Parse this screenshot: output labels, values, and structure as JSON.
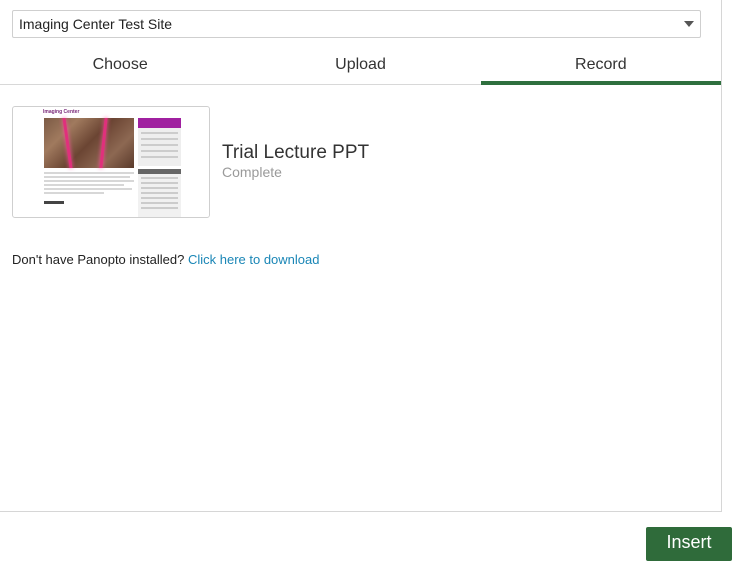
{
  "folder_select": {
    "selected": "Imaging Center Test Site",
    "icon": "chevron-down-icon"
  },
  "tabs": [
    {
      "label": "Choose",
      "active": false
    },
    {
      "label": "Upload",
      "active": false
    },
    {
      "label": "Record",
      "active": true
    }
  ],
  "session": {
    "name": "Trial Lecture PPT",
    "status": "Complete",
    "thumbnail": {
      "site_title": "Imaging Center"
    }
  },
  "download": {
    "prompt": "Don't have Panopto installed?",
    "link_text": "Click here to download"
  },
  "insert_button": {
    "label": "Insert"
  },
  "colors": {
    "accent_green": "#2e6f3e",
    "link_blue": "#1a86b6",
    "status_gray": "#9a9a9a"
  }
}
